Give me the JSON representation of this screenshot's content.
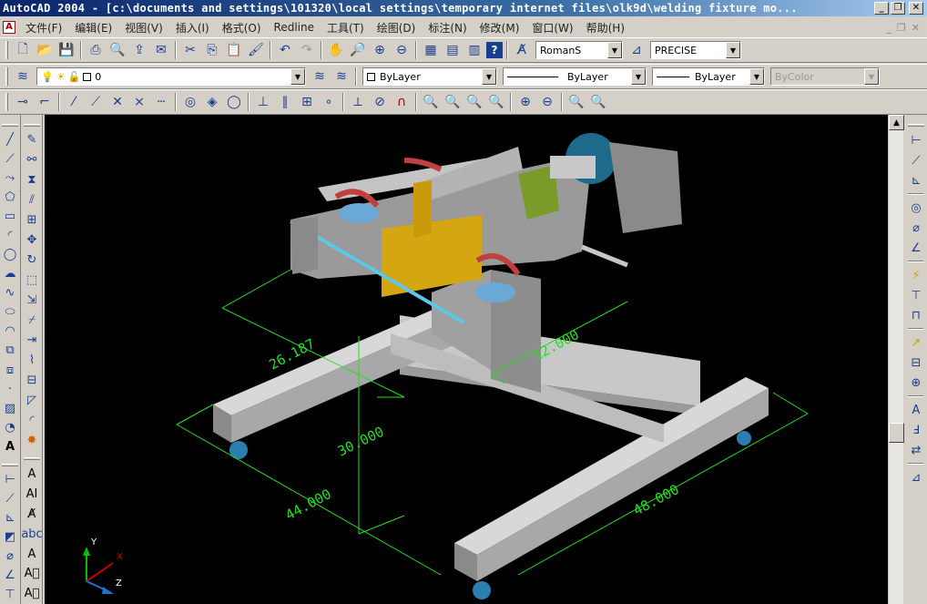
{
  "window": {
    "title": "AutoCAD 2004 - [c:\\documents and settings\\101320\\local settings\\temporary internet files\\olk9d\\welding fixture mo..."
  },
  "menu": {
    "items": [
      "文件(F)",
      "编辑(E)",
      "视图(V)",
      "插入(I)",
      "格式(O)",
      "Redline",
      "工具(T)",
      "绘图(D)",
      "标注(N)",
      "修改(M)",
      "窗口(W)",
      "帮助(H)"
    ]
  },
  "toolbar1": {
    "text_style": "RomanS",
    "dim_style": "PRECISE"
  },
  "toolbar2": {
    "layer": "0",
    "color": "ByLayer",
    "linetype": "ByLayer",
    "lineweight": "ByLayer",
    "plotstyle": "ByColor"
  },
  "drawing": {
    "dimensions": [
      "26.187",
      "12.000",
      "30.000",
      "44.000",
      "48.000"
    ],
    "ucs": {
      "x": "X",
      "y": "Y",
      "z": "Z"
    }
  },
  "icons": {
    "caption": [
      "minimize-icon",
      "restore-icon",
      "close-icon"
    ],
    "accent": "#0a246a",
    "canvas_bg": "#000000",
    "dim_color": "#22e01e"
  }
}
